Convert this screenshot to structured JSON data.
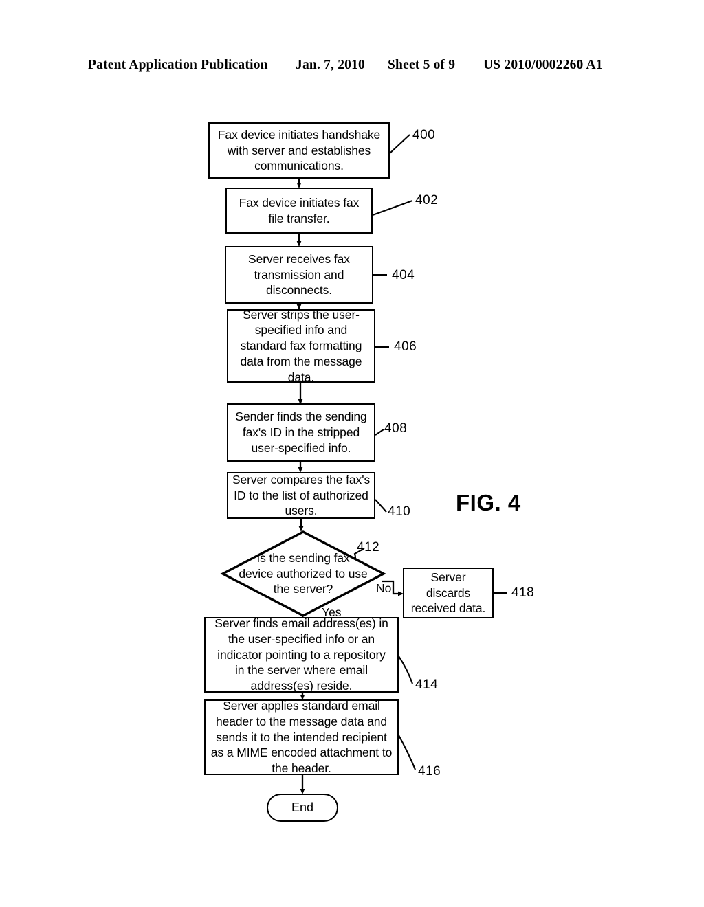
{
  "header": {
    "publication": "Patent Application Publication",
    "date": "Jan. 7, 2010",
    "sheet": "Sheet 5 of 9",
    "patent_number": "US 2010/0002260 A1"
  },
  "figure": {
    "caption": "FIG. 4",
    "branch_labels": {
      "yes": "Yes",
      "no": "No"
    },
    "nodes": [
      {
        "id": "400",
        "ref": "400",
        "type": "process",
        "text": "Fax device initiates handshake\nwith server and establishes\ncommunications."
      },
      {
        "id": "402",
        "ref": "402",
        "type": "process",
        "text": "Fax device initiates fax\nfile transfer."
      },
      {
        "id": "404",
        "ref": "404",
        "type": "process",
        "text": "Server receives fax\ntransmission and\ndisconnects."
      },
      {
        "id": "406",
        "ref": "406",
        "type": "process",
        "text": "Server strips the user-\nspecified info and\nstandard fax formatting\ndata from the message\ndata."
      },
      {
        "id": "408",
        "ref": "408",
        "type": "process",
        "text": "Sender finds the sending\nfax's ID in the stripped\nuser-specified info."
      },
      {
        "id": "410",
        "ref": "410",
        "type": "process",
        "text": "Server compares the fax's\nID to the list of authorized\nusers."
      },
      {
        "id": "412",
        "ref": "412",
        "type": "decision",
        "text": "Is the sending fax\ndevice authorized to use\nthe server?"
      },
      {
        "id": "414",
        "ref": "414",
        "type": "process",
        "text": "Server finds email address(es) in\nthe user-specified info or an\nindicator pointing  to a repository\nin the server where email\naddress(es) reside."
      },
      {
        "id": "416",
        "ref": "416",
        "type": "process",
        "text": "Server applies standard email\nheader to the message data and\nsends it to the intended recipient\nas a MIME encoded attachment to\nthe header."
      },
      {
        "id": "418",
        "ref": "418",
        "type": "process",
        "text": "Server discards\nreceived data."
      },
      {
        "id": "end",
        "ref": "",
        "type": "terminator",
        "text": "End"
      }
    ]
  },
  "colors": {
    "ink": "#000000",
    "paper": "#ffffff"
  }
}
